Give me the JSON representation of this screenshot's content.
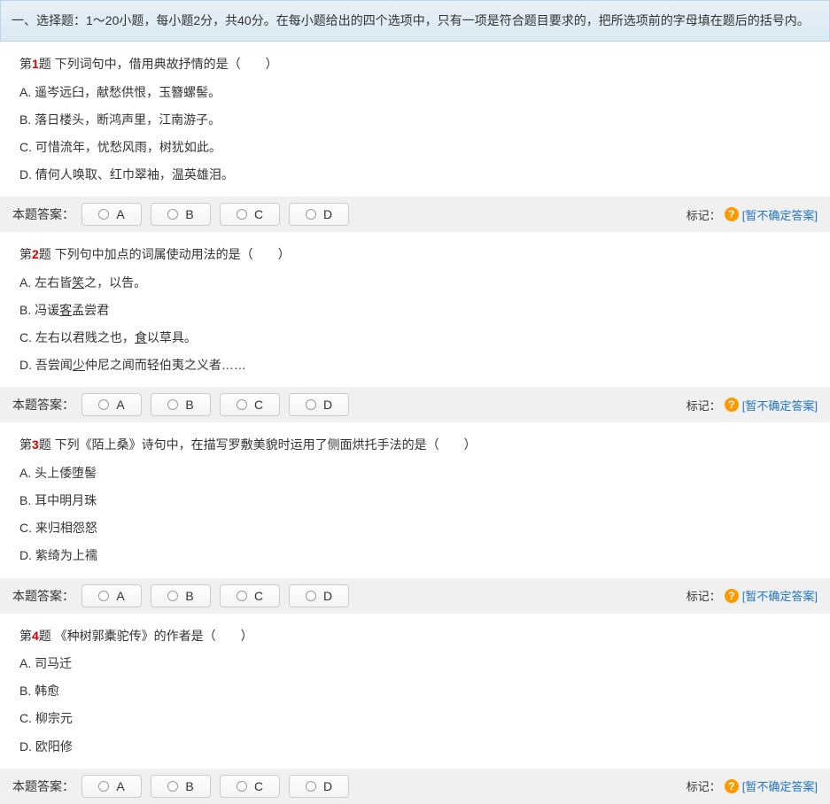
{
  "header": "一、选择题：1～20小题，每小题2分，共40分。在每小题给出的四个选项中，只有一项是符合题目要求的，把所选项前的字母填在题后的括号内。",
  "answer_label": "本题答案：",
  "mark_label": "标记：",
  "uncertain_text": "[暂不确定答案]",
  "choice_labels": [
    "A",
    "B",
    "C",
    "D"
  ],
  "questions": [
    {
      "num_prefix": "第",
      "num": "1",
      "num_suffix": "题",
      "stem": "下列词句中，借用典故抒情的是（　　）",
      "options": [
        {
          "letter": "A.",
          "text": "遥岑远臼，献愁供恨，玉簪螺髻。"
        },
        {
          "letter": "B.",
          "text": "落日楼头，断鸿声里，江南游子。"
        },
        {
          "letter": "C.",
          "text": "可惜流年，忧愁风雨，树犹如此。"
        },
        {
          "letter": "D.",
          "text": "倩何人唤取、红巾翠袖，温英雄泪。"
        }
      ]
    },
    {
      "num_prefix": "第",
      "num": "2",
      "num_suffix": "题",
      "stem": "下列句中加点的词属使动用法的是（　　）",
      "options": [
        {
          "letter": "A.",
          "text_pre": "左右皆",
          "underline": "笑",
          "text_post": "之，以告。"
        },
        {
          "letter": "B.",
          "text_pre": "冯谖",
          "underline": "客",
          "text_post": "孟尝君"
        },
        {
          "letter": "C.",
          "text_pre": "左右以君贱之也，",
          "underline": "食",
          "text_post": "以草具。"
        },
        {
          "letter": "D.",
          "text_pre": "吾尝闻",
          "underline": "少",
          "text_post": "仲尼之闻而轻伯夷之义者……"
        }
      ]
    },
    {
      "num_prefix": "第",
      "num": "3",
      "num_suffix": "题",
      "stem": "下列《陌上桑》诗句中，在描写罗敷美貌时运用了侧面烘托手法的是（　　）",
      "options": [
        {
          "letter": "A.",
          "text": "头上倭堕髻"
        },
        {
          "letter": "B.",
          "text": "耳中明月珠"
        },
        {
          "letter": "C.",
          "text": "来归相怨怒"
        },
        {
          "letter": "D.",
          "text": "紫绮为上襦"
        }
      ]
    },
    {
      "num_prefix": "第",
      "num": "4",
      "num_suffix": "题",
      "stem": "《种树郭橐驼传》的作者是（　　）",
      "options": [
        {
          "letter": "A.",
          "text": "司马迁"
        },
        {
          "letter": "B.",
          "text": "韩愈"
        },
        {
          "letter": "C.",
          "text": "柳宗元"
        },
        {
          "letter": "D.",
          "text": "欧阳修"
        }
      ]
    }
  ]
}
